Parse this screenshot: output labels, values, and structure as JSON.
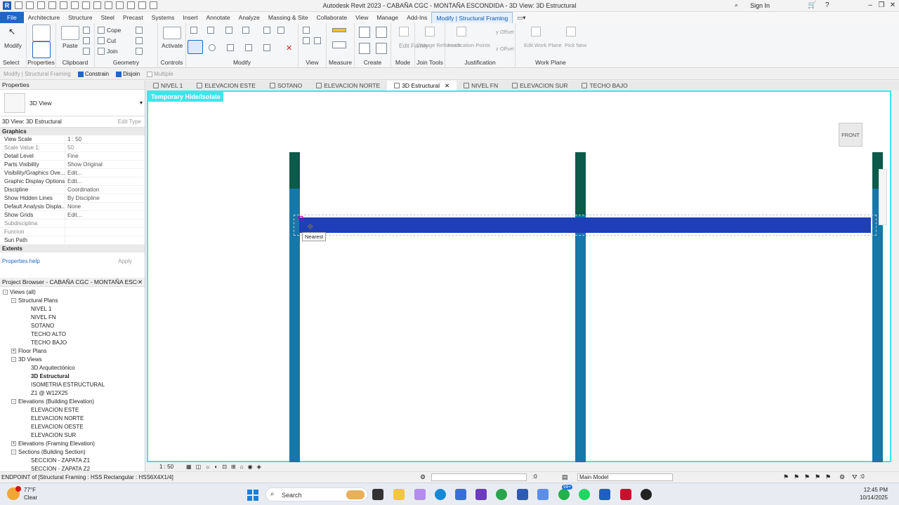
{
  "window": {
    "title": "Autodesk Revit 2023 - CABAÑA CGC - MONTAÑA ESCONDIDA - 3D View: 3D Estructural",
    "sign_in": "Sign In"
  },
  "menu": {
    "items": [
      "File",
      "Architecture",
      "Structure",
      "Steel",
      "Precast",
      "Systems",
      "Insert",
      "Annotate",
      "Analyze",
      "Massing & Site",
      "Collaborate",
      "View",
      "Manage",
      "Add-Ins",
      "Modify | Structural Framing"
    ]
  },
  "ribbon": {
    "modify": "Modify",
    "select": "Select",
    "properties": "Properties",
    "paste": "Paste",
    "clipboard": "Clipboard",
    "cope": "Cope",
    "cut": "Cut",
    "join": "Join",
    "geometry": "Geometry",
    "activate": "Activate",
    "controls": "Controls",
    "modify_group": "Modify",
    "view": "View",
    "measure": "Measure",
    "create": "Create",
    "edit_family": "Edit Family",
    "change_reference": "Change Reference",
    "justification_points": "Justification Points",
    "mode": "Mode",
    "join_tools": "Join Tools",
    "justification": "Justification",
    "y_offset": "y Offset",
    "z_offset": "z Offset",
    "edit_work_plane": "Edit Work Plane",
    "pick_new": "Pick New",
    "work_plane": "Work Plane"
  },
  "options_bar": {
    "context": "Modify | Structural Framing",
    "constrain": "Constrain",
    "disjoin": "Disjoin",
    "multiple": "Multiple"
  },
  "view_tabs": [
    {
      "label": "NIVEL 1"
    },
    {
      "label": "ELEVACION ESTE"
    },
    {
      "label": "SOTANO"
    },
    {
      "label": "ELEVACION NORTE"
    },
    {
      "label": "3D Estructural"
    },
    {
      "label": "NIVEL FN"
    },
    {
      "label": "ELEVACION SUR"
    },
    {
      "label": "TECHO BAJO"
    }
  ],
  "properties": {
    "title": "Properties",
    "type_name": "3D View",
    "selector": "3D View: 3D Estructural",
    "edit_type": "Edit Type",
    "graphics_section": "Graphics",
    "rows": [
      {
        "k": "View Scale",
        "v": "1 : 50"
      },
      {
        "k": "Scale Value    1:",
        "v": "50"
      },
      {
        "k": "Detail Level",
        "v": "Fine"
      },
      {
        "k": "Parts Visibility",
        "v": "Show Original"
      },
      {
        "k": "Visibility/Graphics Ove...",
        "v": "Edit..."
      },
      {
        "k": "Graphic Display Options",
        "v": "Edit..."
      },
      {
        "k": "Discipline",
        "v": "Coordination"
      },
      {
        "k": "Show Hidden Lines",
        "v": "By Discipline"
      },
      {
        "k": "Default Analysis Displa...",
        "v": "None"
      },
      {
        "k": "Show Grids",
        "v": "Edit..."
      },
      {
        "k": "Subdisciplina",
        "v": ""
      },
      {
        "k": "Funcion",
        "v": ""
      },
      {
        "k": "Sun Path",
        "v": ""
      }
    ],
    "extents_section": "Extents",
    "help": "Properties help",
    "apply": "Apply"
  },
  "project_browser": {
    "title": "Project Browser - CABAÑA CGC - MONTAÑA ESCON...",
    "items": [
      {
        "label": "Views (all)",
        "level": 1,
        "tog": "-"
      },
      {
        "label": "Structural Plans",
        "level": 2,
        "tog": "-"
      },
      {
        "label": "NIVEL 1",
        "level": 3
      },
      {
        "label": "NIVEL FN",
        "level": 3
      },
      {
        "label": "SOTANO",
        "level": 3
      },
      {
        "label": "TECHO ALTO",
        "level": 3
      },
      {
        "label": "TECHO BAJO",
        "level": 3
      },
      {
        "label": "Floor Plans",
        "level": 2,
        "tog": "+"
      },
      {
        "label": "3D Views",
        "level": 2,
        "tog": "-"
      },
      {
        "label": "3D Arquitectónico",
        "level": 3
      },
      {
        "label": "3D Estructural",
        "level": 3,
        "bold": true
      },
      {
        "label": "ISOMETRIA ESTRUCTURAL",
        "level": 3
      },
      {
        "label": "Z1 @ W12X25",
        "level": 3
      },
      {
        "label": "Elevations (Building Elevation)",
        "level": 2,
        "tog": "-"
      },
      {
        "label": "ELEVACION ESTE",
        "level": 3
      },
      {
        "label": "ELEVACION NORTE",
        "level": 3
      },
      {
        "label": "ELEVACION OESTE",
        "level": 3
      },
      {
        "label": "ELEVACION SUR",
        "level": 3
      },
      {
        "label": "Elevations (Framing Elevation)",
        "level": 2,
        "tog": "+"
      },
      {
        "label": "Sections (Building Section)",
        "level": 2,
        "tog": "-"
      },
      {
        "label": "SECCION - ZAPATA Z1",
        "level": 3
      },
      {
        "label": "SECCION - ZAPATA Z2",
        "level": 3
      }
    ]
  },
  "viewport": {
    "banner": "Temporary Hide/Isolate",
    "viewcube": "FRONT",
    "snap_tooltip": "Nearest"
  },
  "view_controls": {
    "scale": "1 : 50"
  },
  "status": {
    "text": "ENDPOINT of [Structural Framing : HSS Rectangular : HSS6X4X1/4]",
    "select_count": ":0",
    "model": "Main Model",
    "filter_count": ":0"
  },
  "taskbar": {
    "weather_temp": "77°F",
    "weather_desc": "Clear",
    "search": "Search",
    "time": "12:45 PM",
    "date": "10/14/2025",
    "notif_badge": "99+"
  }
}
